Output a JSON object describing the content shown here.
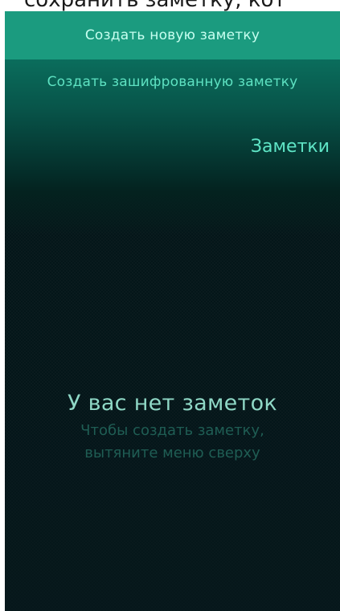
{
  "caption": {
    "text": "сохранить заметку, кот"
  },
  "pulley_menu": {
    "items": [
      {
        "label": "Создать новую заметку",
        "highlighted": true
      },
      {
        "label": "Создать зашифрованную заметку",
        "highlighted": false
      }
    ]
  },
  "header": {
    "title": "Заметки"
  },
  "empty_state": {
    "title": "У вас нет заметок",
    "hint_line1": "Чтобы создать заметку,",
    "hint_line2": "вытяните меню сверху"
  },
  "colors": {
    "accent": "#1b9b7f",
    "highlight_text": "#8ef0d7",
    "background": "#041619"
  }
}
